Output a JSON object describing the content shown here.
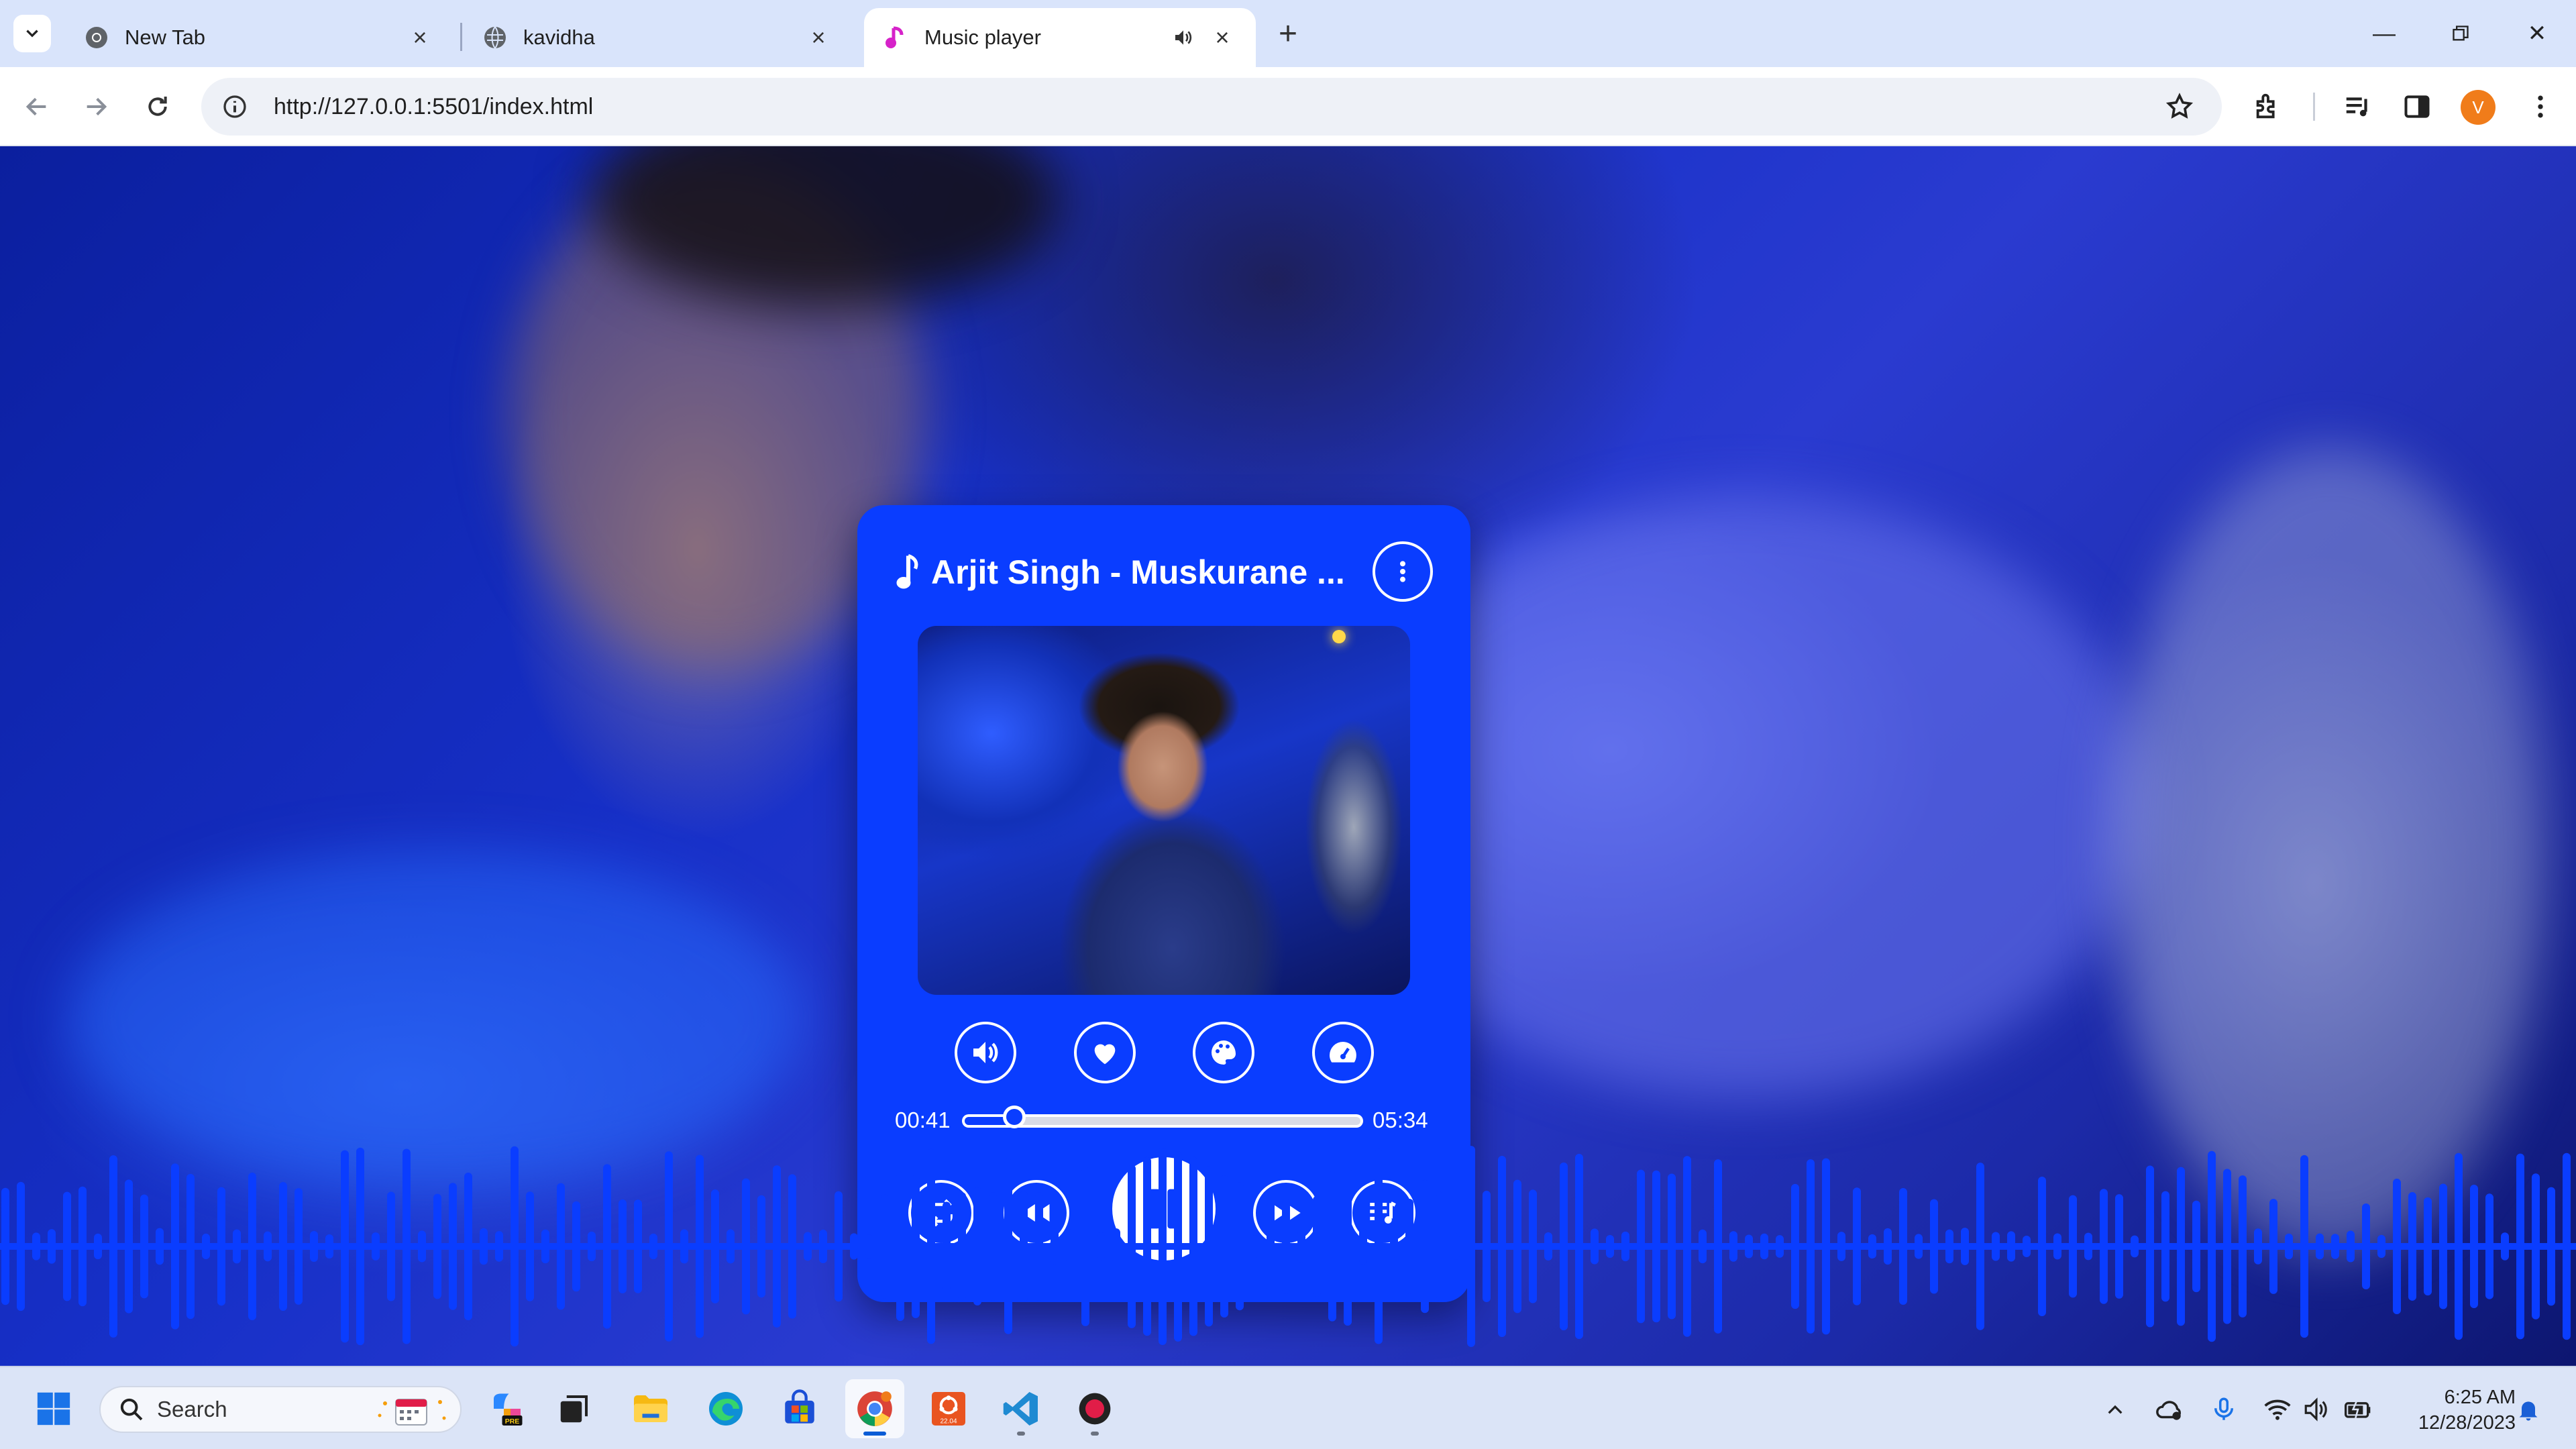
{
  "browser": {
    "tabs": [
      {
        "title": "New Tab",
        "favicon": "chrome-icon",
        "active": false
      },
      {
        "title": "kavidha",
        "favicon": "globe-icon",
        "active": false
      },
      {
        "title": "Music player",
        "favicon": "music-note-icon",
        "active": true,
        "audio_playing": true
      }
    ],
    "url": "http://127.0.0.1:5501/index.html",
    "profile_initial": "V"
  },
  "player": {
    "song_title": "Arjit Singh - Muskurane ...",
    "current_time": "00:41",
    "duration": "05:34",
    "progress_fraction": 0.123,
    "accent_color": "#0a3dff",
    "action_buttons": [
      "volume-icon",
      "heart-icon",
      "palette-icon",
      "speedometer-icon"
    ],
    "control_buttons": [
      "repeat-icon",
      "rewind-icon",
      "pause-icon",
      "fast-forward-icon",
      "playlist-icon"
    ]
  },
  "taskbar": {
    "search_label": "Search",
    "time": "6:25 AM",
    "date": "12/28/2023",
    "pinned_apps": [
      "copilot-pre-icon",
      "task-view-icon",
      "file-explorer-icon",
      "edge-icon",
      "store-icon",
      "chrome-icon",
      "ubuntu-icon",
      "vscode-icon",
      "recorder-icon"
    ],
    "ubuntu_badge": "22.04"
  }
}
